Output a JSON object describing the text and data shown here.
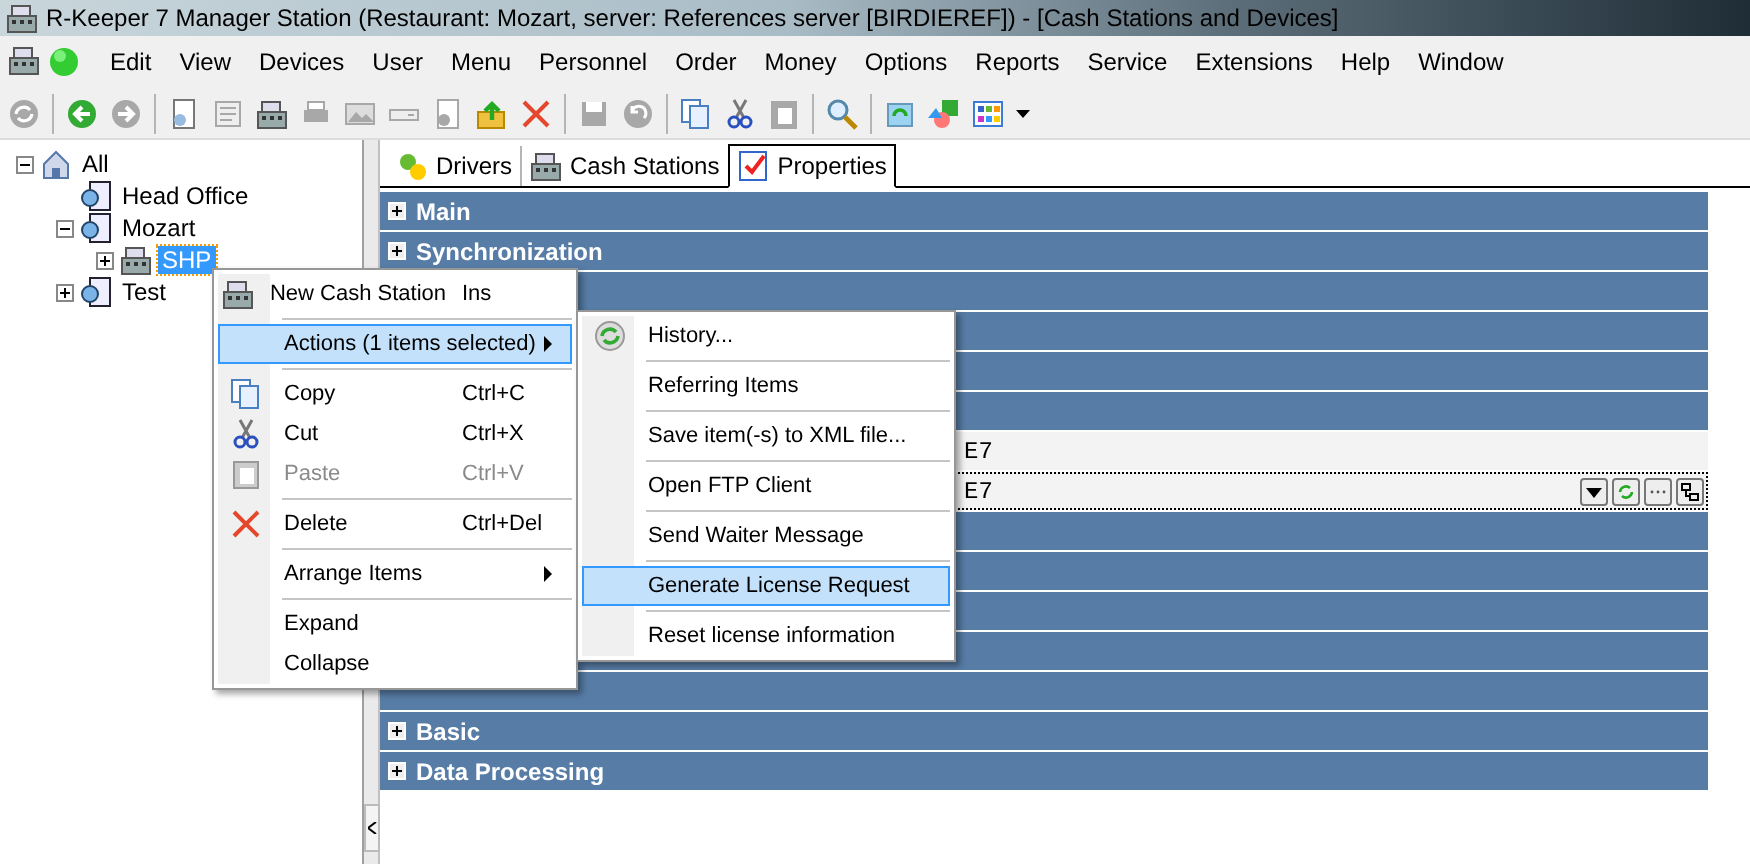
{
  "window": {
    "title": "R-Keeper 7 Manager Station (Restaurant: Mozart, server: References server [BIRDIEREF]) - [Cash Stations and Devices]"
  },
  "menu_bar": [
    "Edit",
    "View",
    "Devices",
    "User",
    "Menu",
    "Personnel",
    "Order",
    "Money",
    "Options",
    "Reports",
    "Service",
    "Extensions",
    "Help",
    "Window"
  ],
  "toolbar": [
    {
      "kind": "refresh",
      "disabled": true
    },
    {
      "kind": "sep"
    },
    {
      "kind": "back",
      "disabled": false
    },
    {
      "kind": "forward",
      "disabled": true
    },
    {
      "kind": "sep"
    },
    {
      "kind": "doc",
      "disabled": false
    },
    {
      "kind": "scroll",
      "disabled": true
    },
    {
      "kind": "register",
      "disabled": false
    },
    {
      "kind": "printer",
      "disabled": true
    },
    {
      "kind": "picture",
      "disabled": true
    },
    {
      "kind": "drive",
      "disabled": true
    },
    {
      "kind": "doc",
      "disabled": true
    },
    {
      "kind": "upload",
      "disabled": false
    },
    {
      "kind": "delete",
      "disabled": false
    },
    {
      "kind": "sep"
    },
    {
      "kind": "save",
      "disabled": true
    },
    {
      "kind": "undo",
      "disabled": true
    },
    {
      "kind": "sep"
    },
    {
      "kind": "copy",
      "disabled": false
    },
    {
      "kind": "cut",
      "disabled": false
    },
    {
      "kind": "paste",
      "disabled": true
    },
    {
      "kind": "sep"
    },
    {
      "kind": "search",
      "disabled": false
    },
    {
      "kind": "sep"
    },
    {
      "kind": "recycle",
      "disabled": false
    },
    {
      "kind": "shapes",
      "disabled": false
    },
    {
      "kind": "grid",
      "disabled": false
    }
  ],
  "tree": [
    {
      "label": "All",
      "kind": "root",
      "expanded": true,
      "selected": false,
      "children": [
        {
          "label": "Head Office",
          "kind": "restaurant",
          "selected": false
        },
        {
          "label": "Mozart",
          "kind": "restaurant",
          "expanded": true,
          "selected": false,
          "children": [
            {
              "label": "SHP",
              "kind": "station",
              "expanded": false,
              "selected": true
            }
          ]
        },
        {
          "label": "Test",
          "kind": "restaurant",
          "expanded": false,
          "selected": false
        }
      ]
    }
  ],
  "tabs": [
    {
      "label": "Drivers",
      "selected": false
    },
    {
      "label": "Cash Stations",
      "selected": false
    },
    {
      "label": "Properties",
      "selected": true
    }
  ],
  "properties": [
    {
      "kind": "group",
      "label": "Main"
    },
    {
      "kind": "group",
      "label": "Synchronization"
    },
    {
      "kind": "group"
    },
    {
      "kind": "group"
    },
    {
      "kind": "group"
    },
    {
      "kind": "group"
    },
    {
      "kind": "field",
      "value": "E7",
      "focused": false
    },
    {
      "kind": "field",
      "value": "E7",
      "focused": true
    },
    {
      "kind": "group"
    },
    {
      "kind": "group"
    },
    {
      "kind": "group"
    },
    {
      "kind": "group"
    },
    {
      "kind": "group"
    },
    {
      "kind": "group",
      "label": "Basic"
    },
    {
      "kind": "group",
      "label": "Data Processing"
    }
  ],
  "context_menu": [
    {
      "kind": "command",
      "label": "New Cash Station",
      "shortcut": "Ins",
      "selected": false,
      "disabled": false
    },
    {
      "kind": "separator"
    },
    {
      "kind": "submenu",
      "label": "Actions (1 items selected)",
      "selected": true,
      "disabled": false
    },
    {
      "kind": "separator"
    },
    {
      "kind": "command",
      "label": "Copy",
      "shortcut": "Ctrl+C",
      "selected": false,
      "disabled": false
    },
    {
      "kind": "command",
      "label": "Cut",
      "shortcut": "Ctrl+X",
      "selected": false,
      "disabled": false
    },
    {
      "kind": "command",
      "label": "Paste",
      "shortcut": "Ctrl+V",
      "selected": false,
      "disabled": true
    },
    {
      "kind": "separator"
    },
    {
      "kind": "command",
      "label": "Delete",
      "shortcut": "Ctrl+Del",
      "selected": false,
      "disabled": false
    },
    {
      "kind": "separator"
    },
    {
      "kind": "submenu",
      "label": "Arrange Items",
      "selected": false,
      "disabled": false
    },
    {
      "kind": "separator"
    },
    {
      "kind": "command",
      "label": "Expand",
      "selected": false,
      "disabled": false
    },
    {
      "kind": "command",
      "label": "Collapse",
      "selected": false,
      "disabled": false
    }
  ],
  "submenu": [
    {
      "kind": "command",
      "label": "History...",
      "selected": false
    },
    {
      "kind": "separator"
    },
    {
      "kind": "command",
      "label": "Referring Items",
      "selected": false
    },
    {
      "kind": "separator"
    },
    {
      "kind": "command",
      "label": "Save item(-s) to XML file...",
      "selected": false
    },
    {
      "kind": "separator"
    },
    {
      "kind": "command",
      "label": "Open FTP Client",
      "selected": false
    },
    {
      "kind": "separator"
    },
    {
      "kind": "command",
      "label": "Send Waiter Message",
      "selected": false
    },
    {
      "kind": "separator"
    },
    {
      "kind": "command",
      "label": "Generate License Request",
      "selected": true
    },
    {
      "kind": "separator"
    },
    {
      "kind": "command",
      "label": "Reset license information",
      "selected": false
    }
  ]
}
